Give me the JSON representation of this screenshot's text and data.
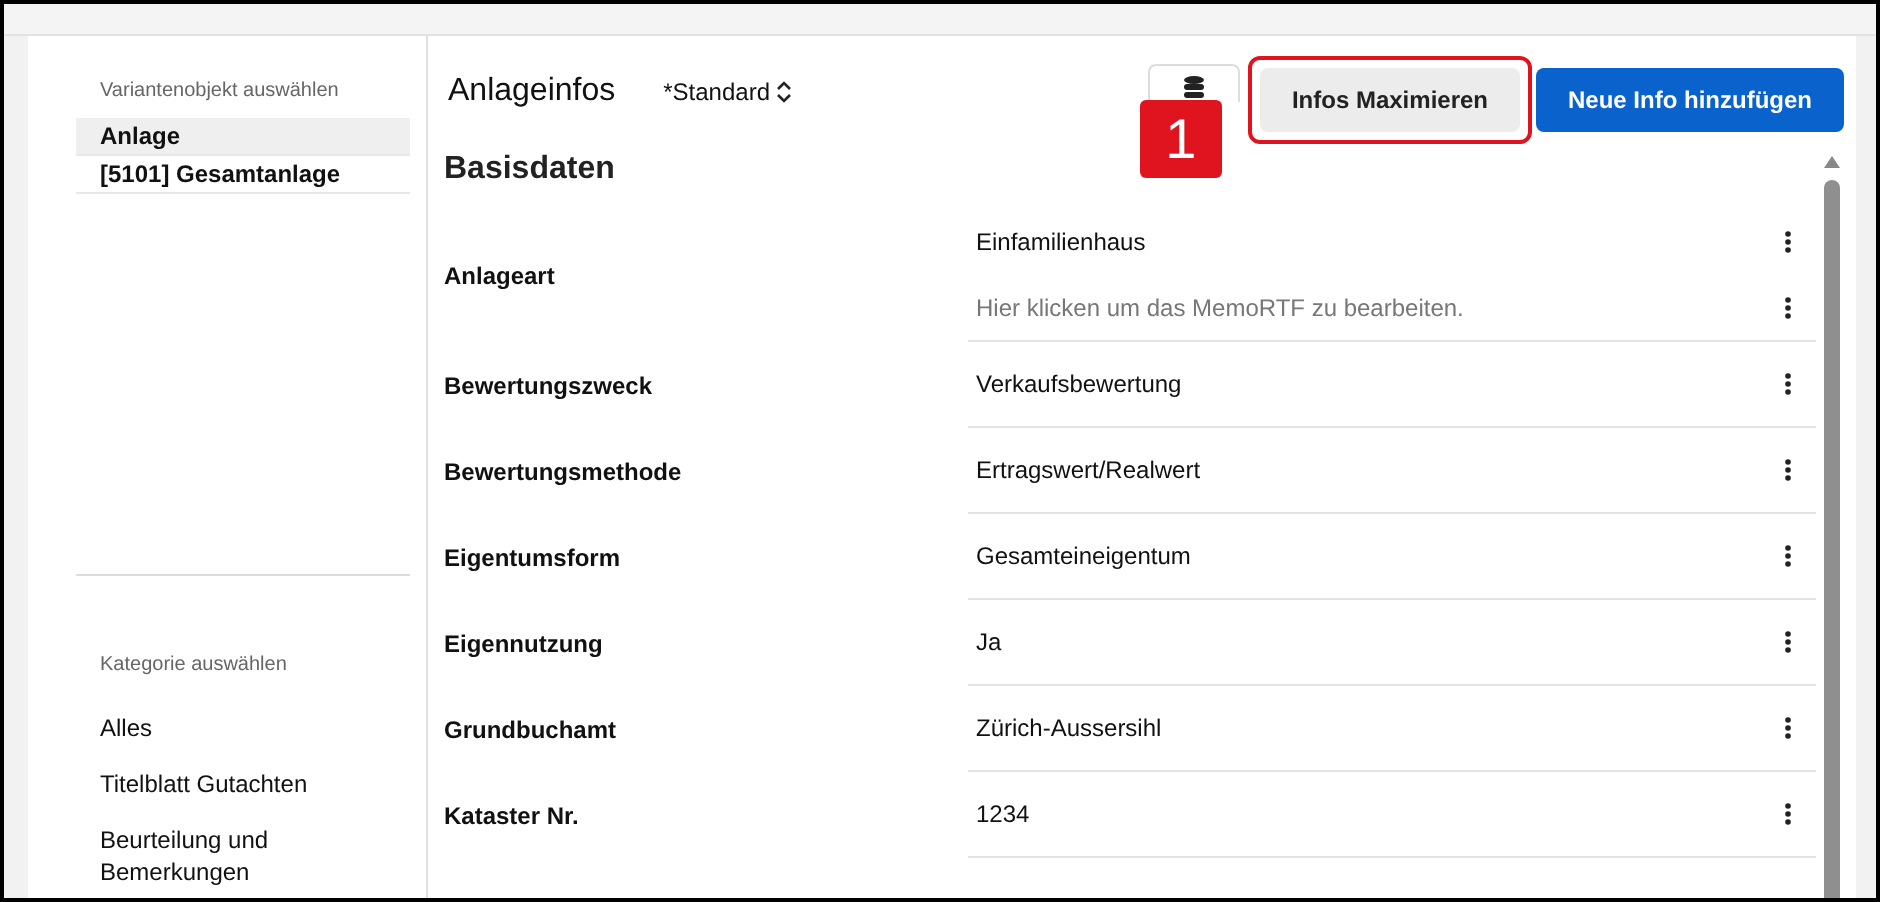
{
  "sidebar": {
    "variant_heading": "Variantenobjekt auswählen",
    "variants": [
      {
        "label": "Anlage",
        "selected": true
      },
      {
        "label": "[5101] Gesamtanlage",
        "selected": false
      }
    ],
    "category_heading": "Kategorie auswählen",
    "categories": [
      {
        "label": "Alles"
      },
      {
        "label": "Titelblatt Gutachten"
      },
      {
        "label": "Beurteilung und Bemerkungen"
      }
    ]
  },
  "header": {
    "title": "Anlageinfos",
    "view": "*Standard",
    "buttons": [
      {
        "label": "Infos Maximieren",
        "kind": "secondary",
        "highlighted": true
      },
      {
        "label": "Neue Info hinzufügen",
        "kind": "primary",
        "highlighted": false
      }
    ],
    "step_badge": "1"
  },
  "section": {
    "title": "Basisdaten",
    "fields": [
      {
        "label": "Anlageart",
        "values": [
          {
            "text": "Einfamilienhaus",
            "kind": "value"
          },
          {
            "text": "Hier klicken um das MemoRTF zu bearbeiten.",
            "kind": "placeholder"
          }
        ]
      },
      {
        "label": "Bewertungszweck",
        "values": [
          {
            "text": "Verkaufsbewertung",
            "kind": "value"
          }
        ]
      },
      {
        "label": "Bewertungsmethode",
        "values": [
          {
            "text": "Ertragswert/Realwert",
            "kind": "value"
          }
        ]
      },
      {
        "label": "Eigentumsform",
        "values": [
          {
            "text": "Gesamteineigentum",
            "kind": "value"
          }
        ]
      },
      {
        "label": "Eigennutzung",
        "values": [
          {
            "text": "Ja",
            "kind": "value"
          }
        ]
      },
      {
        "label": "Grundbuchamt",
        "values": [
          {
            "text": "Zürich-Aussersihl",
            "kind": "value"
          }
        ]
      },
      {
        "label": "Kataster Nr.",
        "values": [
          {
            "text": "1234",
            "kind": "value"
          }
        ]
      }
    ]
  }
}
